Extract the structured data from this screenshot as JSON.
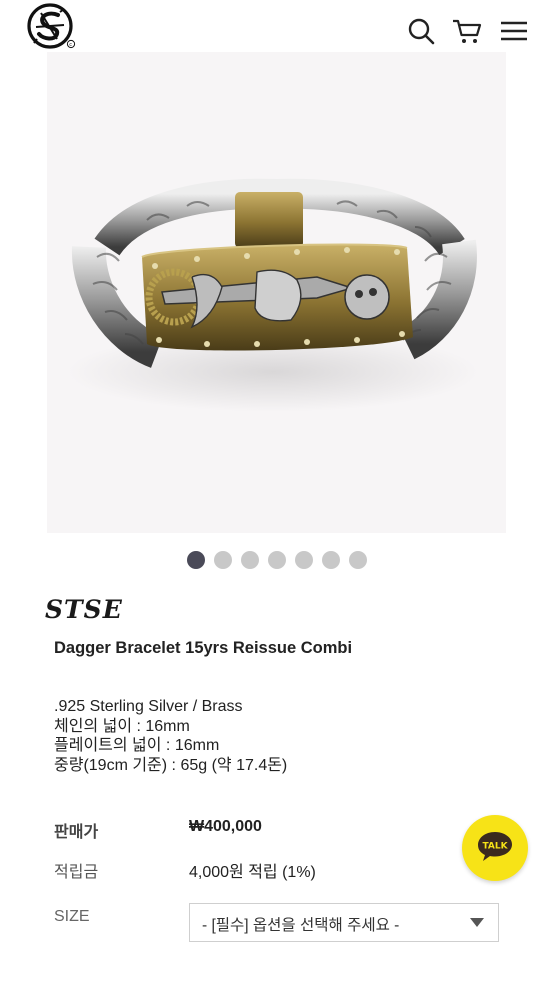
{
  "header": {
    "logo_icon": "stse-circle-logo-icon",
    "search_icon": "search-icon",
    "cart_icon": "cart-icon",
    "menu_icon": "hamburger-menu-icon"
  },
  "gallery": {
    "image_alt": "Dagger Bracelet product photo",
    "dot_count": 7,
    "active_index": 0
  },
  "product": {
    "brand": "STSE",
    "title": "Dagger Bracelet 15yrs Reissue Combi",
    "description": [
      ".925 Sterling Silver / Brass",
      "체인의 넓이 : 16mm",
      "플레이트의 넓이 : 16mm",
      "중량(19cm 기준) : 65g (약 17.4돈)"
    ]
  },
  "pricing": {
    "price_label": "판매가",
    "price_value": "₩400,000",
    "points_label": "적립금",
    "points_value": "4,000원 적립 (1%)"
  },
  "options": {
    "size_label": "SIZE",
    "size_selected": "- [필수] 옵션을 선택해 주세요 -"
  },
  "talk_button": {
    "label": "TALK",
    "color": "#f7e317"
  },
  "colors": {
    "active_dot": "#4a4a58",
    "inactive_dot": "#c8c8c8",
    "talk_yellow": "#f7e317"
  }
}
